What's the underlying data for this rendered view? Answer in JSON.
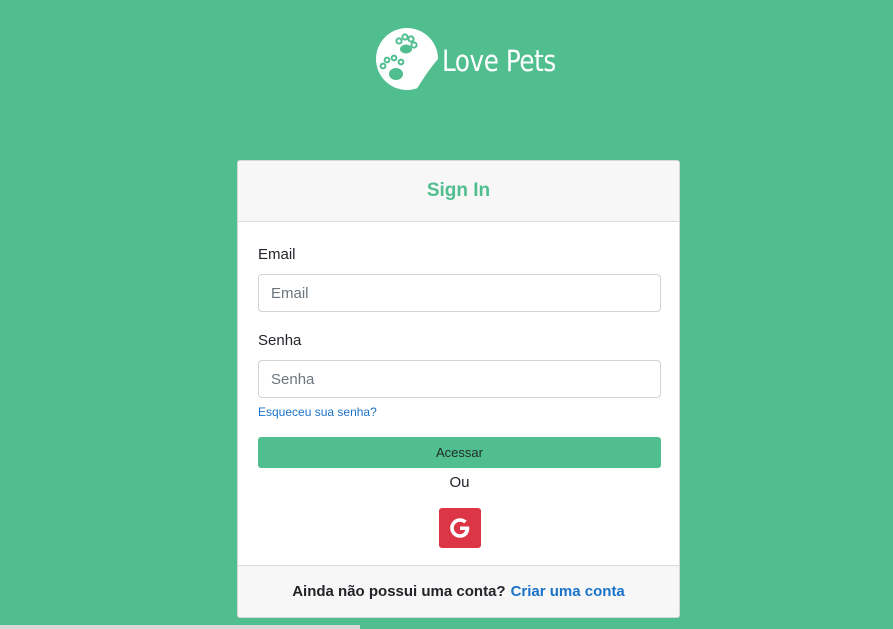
{
  "brand": {
    "name": "Love Pets",
    "logo_icon": "paw-prints-icon"
  },
  "card": {
    "title": "Sign In",
    "email": {
      "label": "Email",
      "placeholder": "Email",
      "value": ""
    },
    "password": {
      "label": "Senha",
      "placeholder": "Senha",
      "value": ""
    },
    "forgot_label": "Esqueceu sua senha?",
    "submit_label": "Acessar",
    "or_label": "Ou",
    "google_icon": "google-icon",
    "footer": {
      "prompt": "Ainda não possui uma conta?",
      "link_label": "Criar uma conta"
    }
  },
  "colors": {
    "background": "#50be8f",
    "accent": "#50be8f",
    "google": "#dc3545",
    "link": "#1a73c8"
  }
}
